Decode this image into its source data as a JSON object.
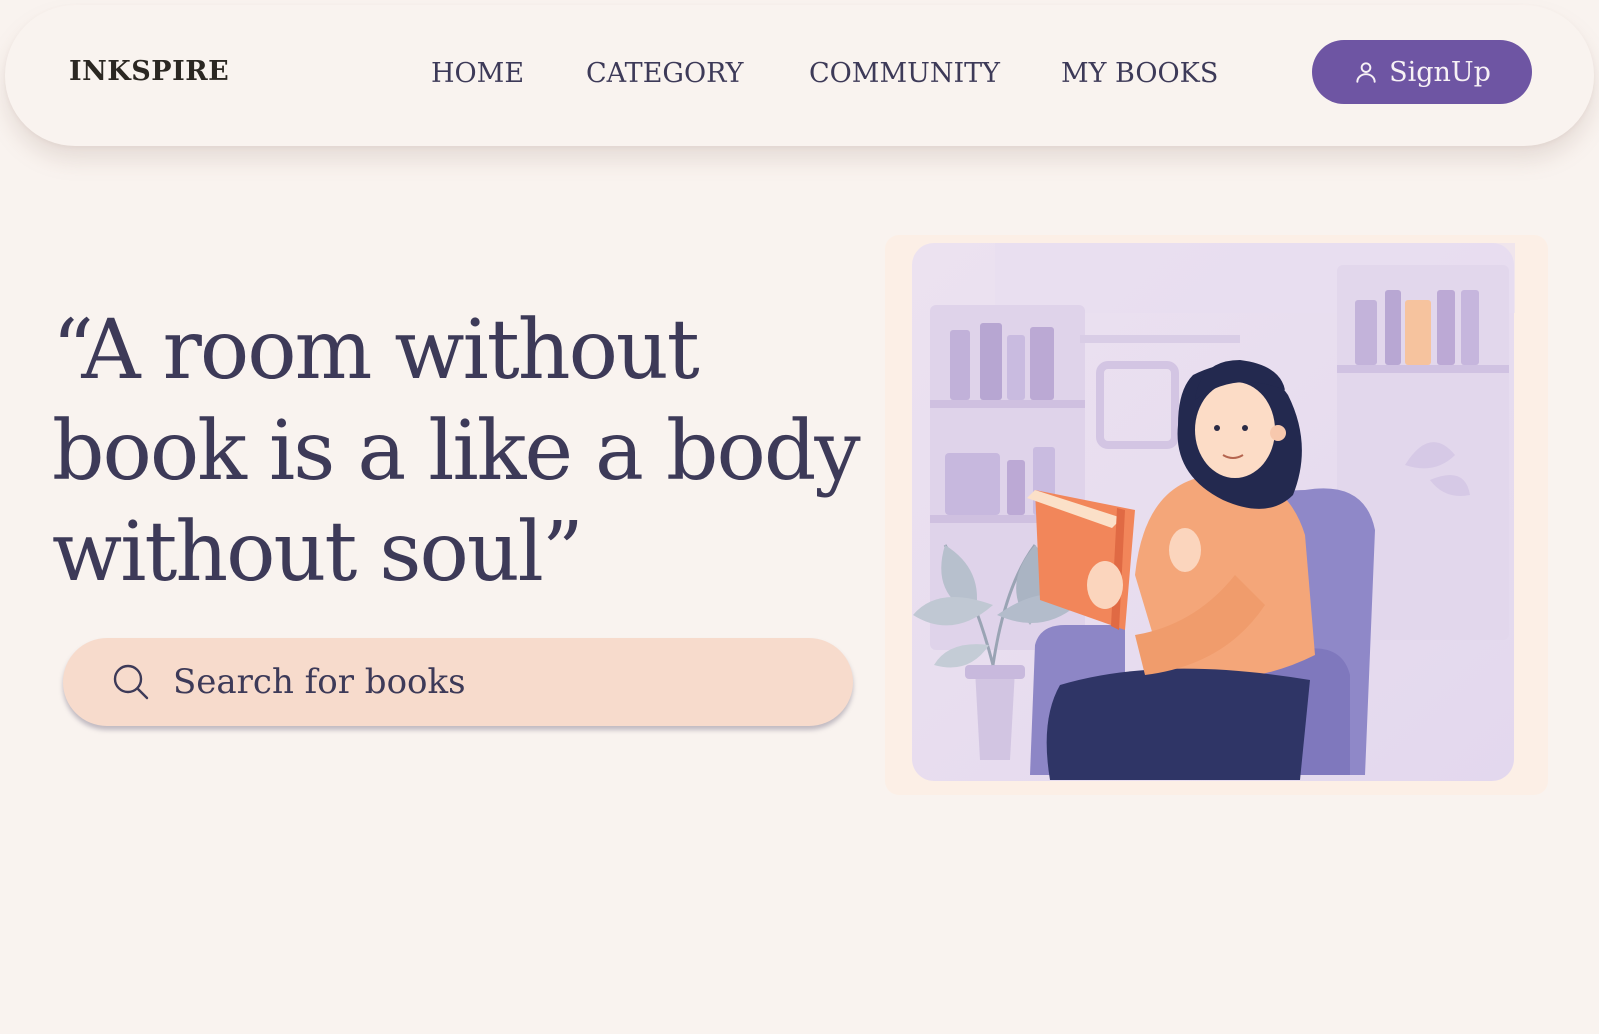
{
  "brand": {
    "name": "INKSPIRE"
  },
  "nav": {
    "items": [
      {
        "label": "HOME"
      },
      {
        "label": "CATEGORY"
      },
      {
        "label": "COMMUNITY"
      },
      {
        "label": "MY BOOKS"
      }
    ],
    "signup_label": "SignUp",
    "signup_icon": "user-icon",
    "accent_color": "#6e55a3"
  },
  "hero": {
    "quote_line1": "“A room without",
    "quote_line2": "book is a like a body",
    "quote_line3": "without soul”",
    "search": {
      "placeholder": "Search for books",
      "icon": "search-icon",
      "color": "#f7dbcc"
    },
    "image": {
      "icon": "reading-woman-illustration"
    }
  }
}
